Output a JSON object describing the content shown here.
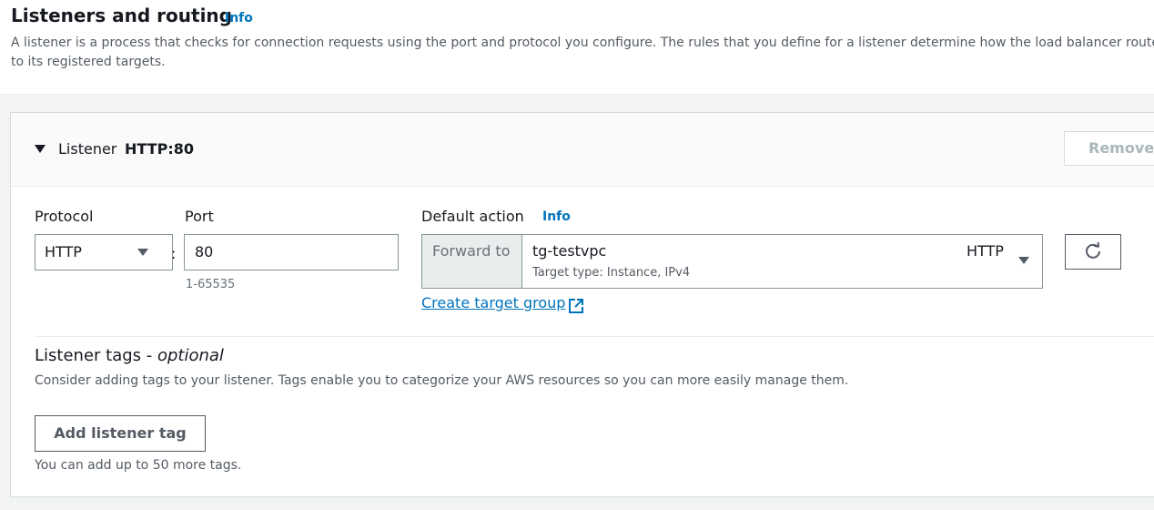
{
  "section": {
    "title": "Listeners and routing",
    "info_label": "Info",
    "description_line1": "A listener is a process that checks for connection requests using the port and protocol you configure. The rules that you define for a listener determine how the load balancer routes requ",
    "description_line2": "to its registered targets."
  },
  "listener": {
    "header_label": "Listener",
    "name": "HTTP:80",
    "remove_label": "Remove",
    "protocol_label": "Protocol",
    "protocol_value": "HTTP",
    "port_label": "Port",
    "colon": ":",
    "port_value": "80",
    "port_hint": "1-65535",
    "default_action_label": "Default action",
    "default_action_info": "Info",
    "forward_to_label": "Forward to",
    "target_group_name": "tg-testvpc",
    "target_group_subtext": "Target type: Instance, IPv4",
    "target_group_protocol": "HTTP",
    "create_target_group_link": "Create target group"
  },
  "tags": {
    "title_main": "Listener tags - ",
    "title_optional": "optional",
    "description": "Consider adding tags to your listener. Tags enable you to categorize your AWS resources so you can more easily manage them.",
    "add_button_label": "Add listener tag",
    "limit_hint": "You can add up to 50 more tags."
  },
  "icons": {
    "expand": "caret-down-icon",
    "dropdown": "chevron-down-icon",
    "refresh": "refresh-icon",
    "external": "external-link-icon"
  },
  "colors": {
    "link": "#0073bb",
    "text": "#16191f",
    "secondary_text": "#545b64",
    "border": "#879596",
    "disabled": "#aab7b8"
  }
}
